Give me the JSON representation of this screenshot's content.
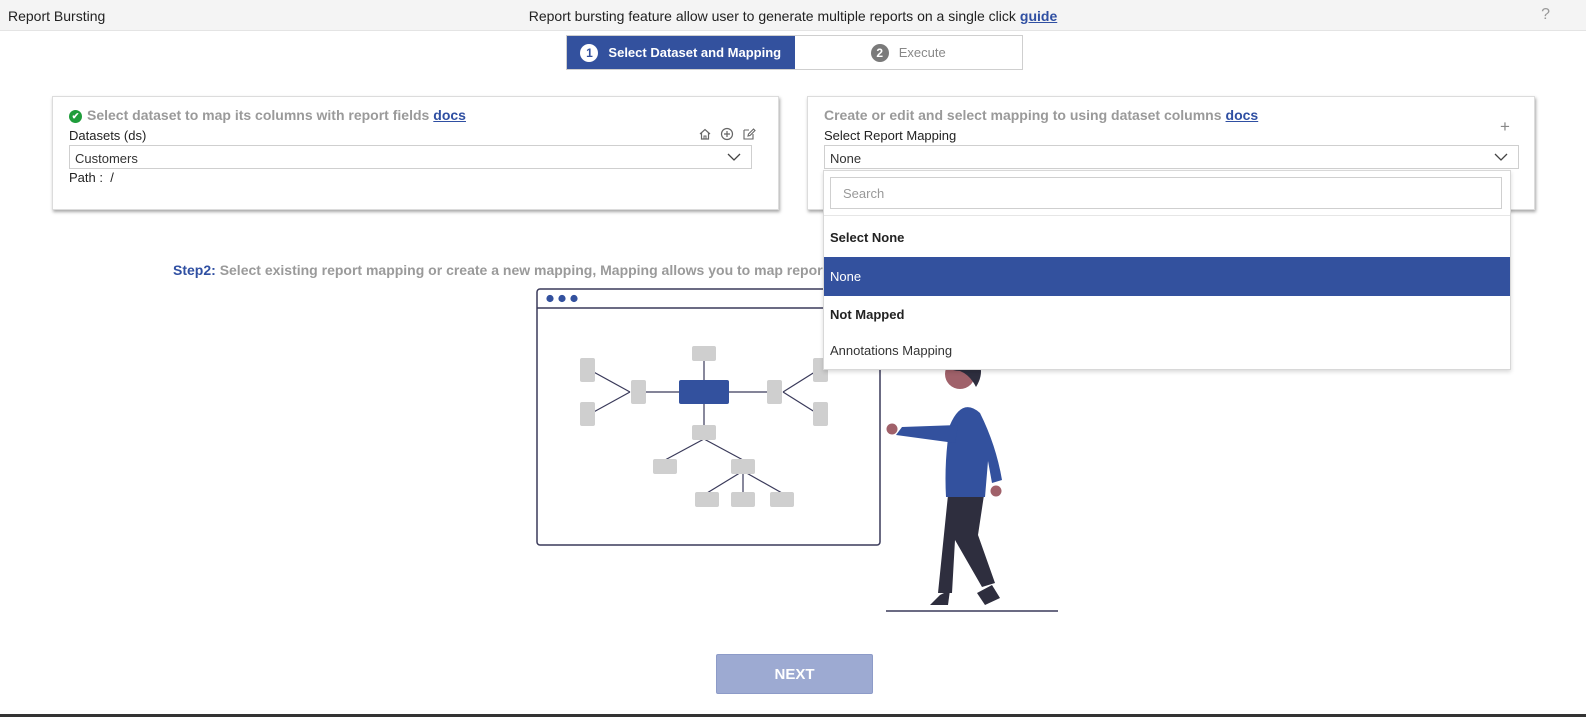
{
  "header": {
    "app_title": "Report Bursting",
    "banner_text": "Report bursting feature allow user to generate multiple reports on a single click",
    "banner_link": "guide",
    "help_label": "?"
  },
  "stepper": {
    "steps": [
      {
        "number": "1",
        "label": "Select Dataset and Mapping",
        "active": true
      },
      {
        "number": "2",
        "label": "Execute",
        "active": false
      }
    ]
  },
  "dataset_card": {
    "title": "Select dataset to map its columns with report fields",
    "docs_link": "docs",
    "field_label": "Datasets (ds)",
    "selected_value": "Customers",
    "path_label": "Path :",
    "path_value": "/",
    "icons": [
      "home-icon",
      "add-circle-icon",
      "edit-icon"
    ]
  },
  "mapping_card": {
    "title": "Create or edit and select mapping to using dataset columns",
    "docs_link": "docs",
    "field_label": "Select Report Mapping",
    "selected_value": "None",
    "add_icon": "+"
  },
  "dropdown": {
    "search_placeholder": "Search",
    "items": [
      {
        "label": "Select None",
        "kind": "group"
      },
      {
        "label": "None",
        "kind": "option",
        "selected": true
      },
      {
        "label": "Not Mapped",
        "kind": "group"
      },
      {
        "label": "Annotations Mapping",
        "kind": "option",
        "selected": false
      }
    ]
  },
  "step2": {
    "label": "Step2:",
    "text": "Select existing report mapping or create a new mapping, Mapping allows you to map report par"
  },
  "footer": {
    "next_label": "NEXT"
  },
  "colors": {
    "accent": "#33519e",
    "link": "#2f4fa2",
    "success": "#1f9d3b",
    "next_disabled": "#9daad2"
  }
}
